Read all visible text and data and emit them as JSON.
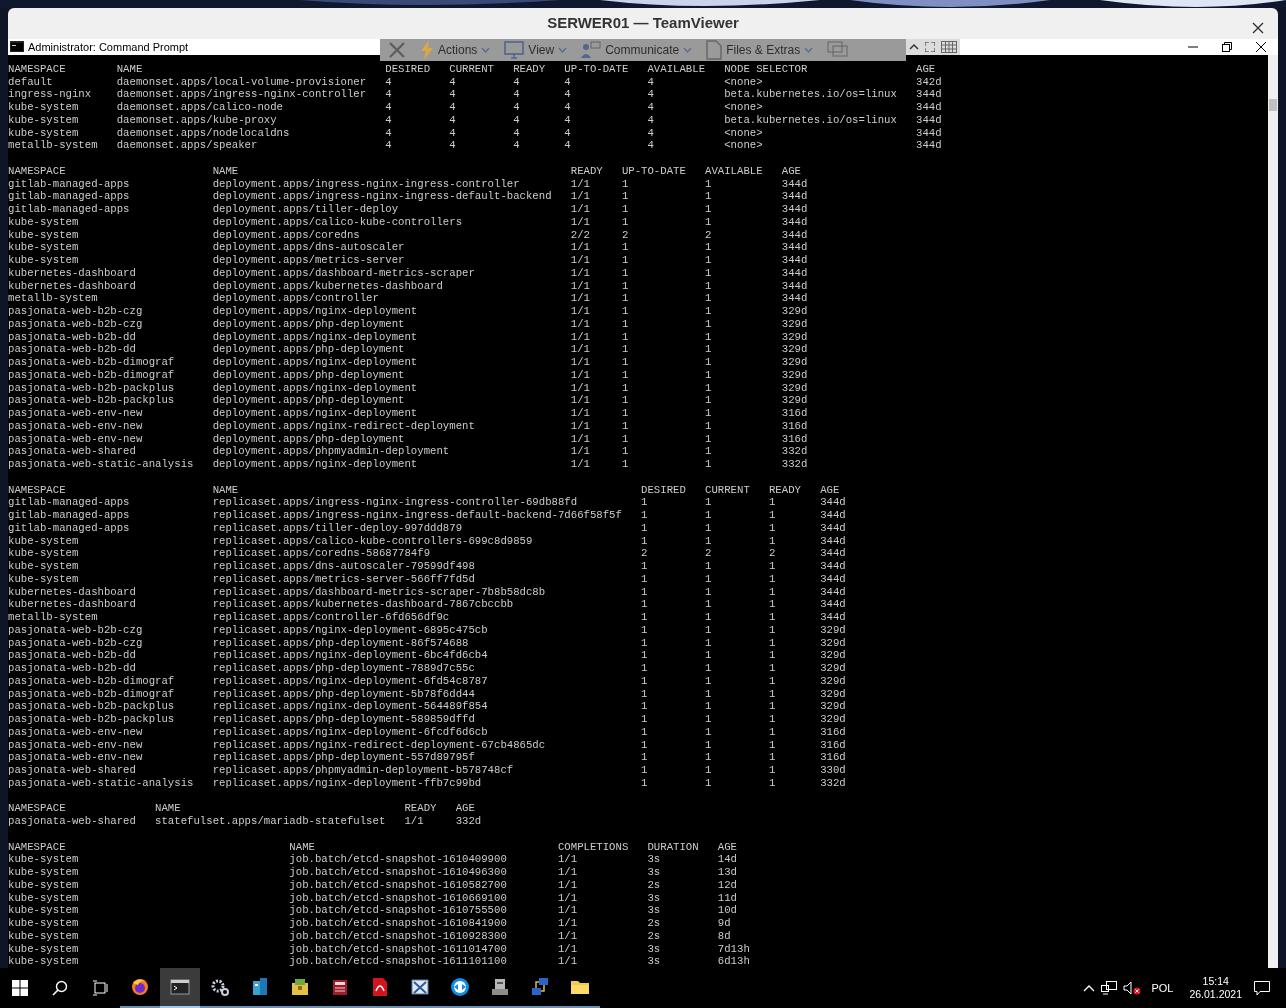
{
  "remote_window": {
    "title": "SERWER01 — TeamViewer"
  },
  "console_window": {
    "title": "Administrator: Command Prompt"
  },
  "toolbar": {
    "items": [
      {
        "kind": "close"
      },
      {
        "kind": "actions",
        "label": "Actions"
      },
      {
        "kind": "view",
        "label": "View"
      },
      {
        "kind": "communicate",
        "label": "Communicate"
      },
      {
        "kind": "files",
        "label": "Files & Extras"
      },
      {
        "kind": "screen"
      }
    ]
  },
  "tables": [
    {
      "columns": [
        "NAMESPACE",
        "NAME",
        "DESIRED",
        "CURRENT",
        "READY",
        "UP-TO-DATE",
        "AVAILABLE",
        "NODE SELECTOR",
        "AGE"
      ],
      "rows": [
        [
          "default",
          "daemonset.apps/local-volume-provisioner",
          "4",
          "4",
          "4",
          "4",
          "4",
          "<none>",
          "342d"
        ],
        [
          "ingress-nginx",
          "daemonset.apps/ingress-nginx-controller",
          "4",
          "4",
          "4",
          "4",
          "4",
          "beta.kubernetes.io/os=linux",
          "344d"
        ],
        [
          "kube-system",
          "daemonset.apps/calico-node",
          "4",
          "4",
          "4",
          "4",
          "4",
          "<none>",
          "344d"
        ],
        [
          "kube-system",
          "daemonset.apps/kube-proxy",
          "4",
          "4",
          "4",
          "4",
          "4",
          "beta.kubernetes.io/os=linux",
          "344d"
        ],
        [
          "kube-system",
          "daemonset.apps/nodelocaldns",
          "4",
          "4",
          "4",
          "4",
          "4",
          "<none>",
          "344d"
        ],
        [
          "metallb-system",
          "daemonset.apps/speaker",
          "4",
          "4",
          "4",
          "4",
          "4",
          "<none>",
          "344d"
        ]
      ]
    },
    {
      "columns": [
        "NAMESPACE",
        "NAME",
        "READY",
        "UP-TO-DATE",
        "AVAILABLE",
        "AGE"
      ],
      "rows": [
        [
          "gitlab-managed-apps",
          "deployment.apps/ingress-nginx-ingress-controller",
          "1/1",
          "1",
          "1",
          "344d"
        ],
        [
          "gitlab-managed-apps",
          "deployment.apps/ingress-nginx-ingress-default-backend",
          "1/1",
          "1",
          "1",
          "344d"
        ],
        [
          "gitlab-managed-apps",
          "deployment.apps/tiller-deploy",
          "1/1",
          "1",
          "1",
          "344d"
        ],
        [
          "kube-system",
          "deployment.apps/calico-kube-controllers",
          "1/1",
          "1",
          "1",
          "344d"
        ],
        [
          "kube-system",
          "deployment.apps/coredns",
          "2/2",
          "2",
          "2",
          "344d"
        ],
        [
          "kube-system",
          "deployment.apps/dns-autoscaler",
          "1/1",
          "1",
          "1",
          "344d"
        ],
        [
          "kube-system",
          "deployment.apps/metrics-server",
          "1/1",
          "1",
          "1",
          "344d"
        ],
        [
          "kubernetes-dashboard",
          "deployment.apps/dashboard-metrics-scraper",
          "1/1",
          "1",
          "1",
          "344d"
        ],
        [
          "kubernetes-dashboard",
          "deployment.apps/kubernetes-dashboard",
          "1/1",
          "1",
          "1",
          "344d"
        ],
        [
          "metallb-system",
          "deployment.apps/controller",
          "1/1",
          "1",
          "1",
          "344d"
        ],
        [
          "pasjonata-web-b2b-czg",
          "deployment.apps/nginx-deployment",
          "1/1",
          "1",
          "1",
          "329d"
        ],
        [
          "pasjonata-web-b2b-czg",
          "deployment.apps/php-deployment",
          "1/1",
          "1",
          "1",
          "329d"
        ],
        [
          "pasjonata-web-b2b-dd",
          "deployment.apps/nginx-deployment",
          "1/1",
          "1",
          "1",
          "329d"
        ],
        [
          "pasjonata-web-b2b-dd",
          "deployment.apps/php-deployment",
          "1/1",
          "1",
          "1",
          "329d"
        ],
        [
          "pasjonata-web-b2b-dimograf",
          "deployment.apps/nginx-deployment",
          "1/1",
          "1",
          "1",
          "329d"
        ],
        [
          "pasjonata-web-b2b-dimograf",
          "deployment.apps/php-deployment",
          "1/1",
          "1",
          "1",
          "329d"
        ],
        [
          "pasjonata-web-b2b-packplus",
          "deployment.apps/nginx-deployment",
          "1/1",
          "1",
          "1",
          "329d"
        ],
        [
          "pasjonata-web-b2b-packplus",
          "deployment.apps/php-deployment",
          "1/1",
          "1",
          "1",
          "329d"
        ],
        [
          "pasjonata-web-env-new",
          "deployment.apps/nginx-deployment",
          "1/1",
          "1",
          "1",
          "316d"
        ],
        [
          "pasjonata-web-env-new",
          "deployment.apps/nginx-redirect-deployment",
          "1/1",
          "1",
          "1",
          "316d"
        ],
        [
          "pasjonata-web-env-new",
          "deployment.apps/php-deployment",
          "1/1",
          "1",
          "1",
          "316d"
        ],
        [
          "pasjonata-web-shared",
          "deployment.apps/phpmyadmin-deployment",
          "1/1",
          "1",
          "1",
          "332d"
        ],
        [
          "pasjonata-web-static-analysis",
          "deployment.apps/nginx-deployment",
          "1/1",
          "1",
          "1",
          "332d"
        ]
      ]
    },
    {
      "columns": [
        "NAMESPACE",
        "NAME",
        "DESIRED",
        "CURRENT",
        "READY",
        "AGE"
      ],
      "rows": [
        [
          "gitlab-managed-apps",
          "replicaset.apps/ingress-nginx-ingress-controller-69db88fd",
          "1",
          "1",
          "1",
          "344d"
        ],
        [
          "gitlab-managed-apps",
          "replicaset.apps/ingress-nginx-ingress-default-backend-7d66f58f5f",
          "1",
          "1",
          "1",
          "344d"
        ],
        [
          "gitlab-managed-apps",
          "replicaset.apps/tiller-deploy-997ddd879",
          "1",
          "1",
          "1",
          "344d"
        ],
        [
          "kube-system",
          "replicaset.apps/calico-kube-controllers-699c8d9859",
          "1",
          "1",
          "1",
          "344d"
        ],
        [
          "kube-system",
          "replicaset.apps/coredns-58687784f9",
          "2",
          "2",
          "2",
          "344d"
        ],
        [
          "kube-system",
          "replicaset.apps/dns-autoscaler-79599df498",
          "1",
          "1",
          "1",
          "344d"
        ],
        [
          "kube-system",
          "replicaset.apps/metrics-server-566ff7fd5d",
          "1",
          "1",
          "1",
          "344d"
        ],
        [
          "kubernetes-dashboard",
          "replicaset.apps/dashboard-metrics-scraper-7b8b58dc8b",
          "1",
          "1",
          "1",
          "344d"
        ],
        [
          "kubernetes-dashboard",
          "replicaset.apps/kubernetes-dashboard-7867cbccbb",
          "1",
          "1",
          "1",
          "344d"
        ],
        [
          "metallb-system",
          "replicaset.apps/controller-6fd656df9c",
          "1",
          "1",
          "1",
          "344d"
        ],
        [
          "pasjonata-web-b2b-czg",
          "replicaset.apps/nginx-deployment-6895c475cb",
          "1",
          "1",
          "1",
          "329d"
        ],
        [
          "pasjonata-web-b2b-czg",
          "replicaset.apps/php-deployment-86f574688",
          "1",
          "1",
          "1",
          "329d"
        ],
        [
          "pasjonata-web-b2b-dd",
          "replicaset.apps/nginx-deployment-6bc4fd6cb4",
          "1",
          "1",
          "1",
          "329d"
        ],
        [
          "pasjonata-web-b2b-dd",
          "replicaset.apps/php-deployment-7889d7c55c",
          "1",
          "1",
          "1",
          "329d"
        ],
        [
          "pasjonata-web-b2b-dimograf",
          "replicaset.apps/nginx-deployment-6fd54c8787",
          "1",
          "1",
          "1",
          "329d"
        ],
        [
          "pasjonata-web-b2b-dimograf",
          "replicaset.apps/php-deployment-5b78f6dd44",
          "1",
          "1",
          "1",
          "329d"
        ],
        [
          "pasjonata-web-b2b-packplus",
          "replicaset.apps/nginx-deployment-564489f854",
          "1",
          "1",
          "1",
          "329d"
        ],
        [
          "pasjonata-web-b2b-packplus",
          "replicaset.apps/php-deployment-589859dffd",
          "1",
          "1",
          "1",
          "329d"
        ],
        [
          "pasjonata-web-env-new",
          "replicaset.apps/nginx-deployment-6fcdf6d6cb",
          "1",
          "1",
          "1",
          "316d"
        ],
        [
          "pasjonata-web-env-new",
          "replicaset.apps/nginx-redirect-deployment-67cb4865dc",
          "1",
          "1",
          "1",
          "316d"
        ],
        [
          "pasjonata-web-env-new",
          "replicaset.apps/php-deployment-557d89795f",
          "1",
          "1",
          "1",
          "316d"
        ],
        [
          "pasjonata-web-shared",
          "replicaset.apps/phpmyadmin-deployment-b578748cf",
          "1",
          "1",
          "1",
          "330d"
        ],
        [
          "pasjonata-web-static-analysis",
          "replicaset.apps/nginx-deployment-ffb7c99bd",
          "1",
          "1",
          "1",
          "332d"
        ]
      ]
    },
    {
      "columns": [
        "NAMESPACE",
        "NAME",
        "READY",
        "AGE"
      ],
      "rows": [
        [
          "pasjonata-web-shared",
          "statefulset.apps/mariadb-statefulset",
          "1/1",
          "332d"
        ]
      ]
    },
    {
      "columns": [
        "NAMESPACE",
        "NAME",
        "COMPLETIONS",
        "DURATION",
        "AGE"
      ],
      "rows": [
        [
          "kube-system",
          "job.batch/etcd-snapshot-1610409900",
          "1/1",
          "3s",
          "14d"
        ],
        [
          "kube-system",
          "job.batch/etcd-snapshot-1610496300",
          "1/1",
          "3s",
          "13d"
        ],
        [
          "kube-system",
          "job.batch/etcd-snapshot-1610582700",
          "1/1",
          "2s",
          "12d"
        ],
        [
          "kube-system",
          "job.batch/etcd-snapshot-1610669100",
          "1/1",
          "3s",
          "11d"
        ],
        [
          "kube-system",
          "job.batch/etcd-snapshot-1610755500",
          "1/1",
          "3s",
          "10d"
        ],
        [
          "kube-system",
          "job.batch/etcd-snapshot-1610841900",
          "1/1",
          "2s",
          "9d"
        ],
        [
          "kube-system",
          "job.batch/etcd-snapshot-1610928300",
          "1/1",
          "2s",
          "8d"
        ],
        [
          "kube-system",
          "job.batch/etcd-snapshot-1611014700",
          "1/1",
          "3s",
          "7d13h"
        ],
        [
          "kube-system",
          "job.batch/etcd-snapshot-1611101100",
          "1/1",
          "3s",
          "6d13h"
        ]
      ]
    }
  ],
  "taskbar": {
    "apps": [
      {
        "kind": "browser",
        "selected": false
      },
      {
        "kind": "terminal",
        "selected": true
      },
      {
        "kind": "gears",
        "selected": false
      },
      {
        "kind": "buildings",
        "selected": false
      },
      {
        "kind": "package",
        "selected": false
      },
      {
        "kind": "archive",
        "selected": false
      },
      {
        "kind": "pdf",
        "selected": false
      },
      {
        "kind": "tool",
        "selected": false
      },
      {
        "kind": "remote",
        "selected": false
      },
      {
        "kind": "drive",
        "selected": false
      },
      {
        "kind": "network",
        "selected": false
      },
      {
        "kind": "folder",
        "selected": false
      }
    ],
    "language": "POL",
    "time": "15:14",
    "date": "26.01.2021"
  }
}
